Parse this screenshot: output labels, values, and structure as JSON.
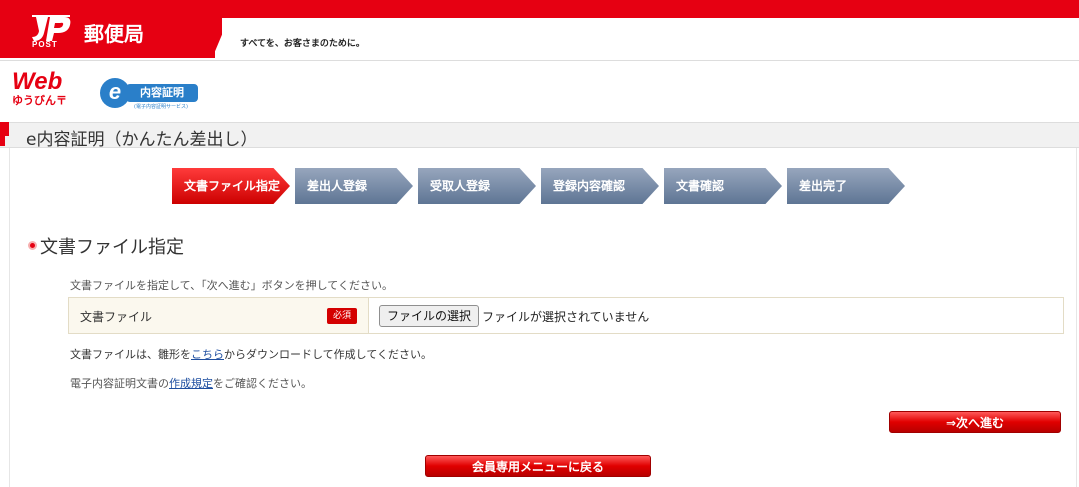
{
  "header": {
    "post_word": "POST",
    "brand": "郵便局",
    "tagline": "すべてを、お客さまのために。",
    "accent_color": "#e60012"
  },
  "logos": {
    "web_word": "Web",
    "web_sub": "ゆうびん〒",
    "econ_badge": "e",
    "econ_title": "内容証明",
    "econ_sub": "(電子内容証明サービス)"
  },
  "page": {
    "title": "e内容証明（かんたん差出し）"
  },
  "steps": [
    {
      "label": "文書ファイル指定",
      "active": true
    },
    {
      "label": "差出人登録",
      "active": false
    },
    {
      "label": "受取人登録",
      "active": false
    },
    {
      "label": "登録内容確認",
      "active": false
    },
    {
      "label": "文書確認",
      "active": false
    },
    {
      "label": "差出完了",
      "active": false
    }
  ],
  "section": {
    "title": "文書ファイル指定",
    "instruction": "文書ファイルを指定して、「次へ進む」ボタンを押してください。"
  },
  "form": {
    "label": "文書ファイル",
    "required_badge": "必須",
    "file_button": "ファイルの選択",
    "file_status": "ファイルが選択されていません"
  },
  "notes": {
    "note1_pre": "文書ファイルは、雛形を",
    "note1_link": "こちら",
    "note1_post": "からダウンロードして作成してください。",
    "note2_pre": "電子内容証明文書の",
    "note2_link": "作成規定",
    "note2_post": "をご確認ください。"
  },
  "buttons": {
    "next": "⇒次へ進む",
    "back": "会員専用メニューに戻る"
  }
}
